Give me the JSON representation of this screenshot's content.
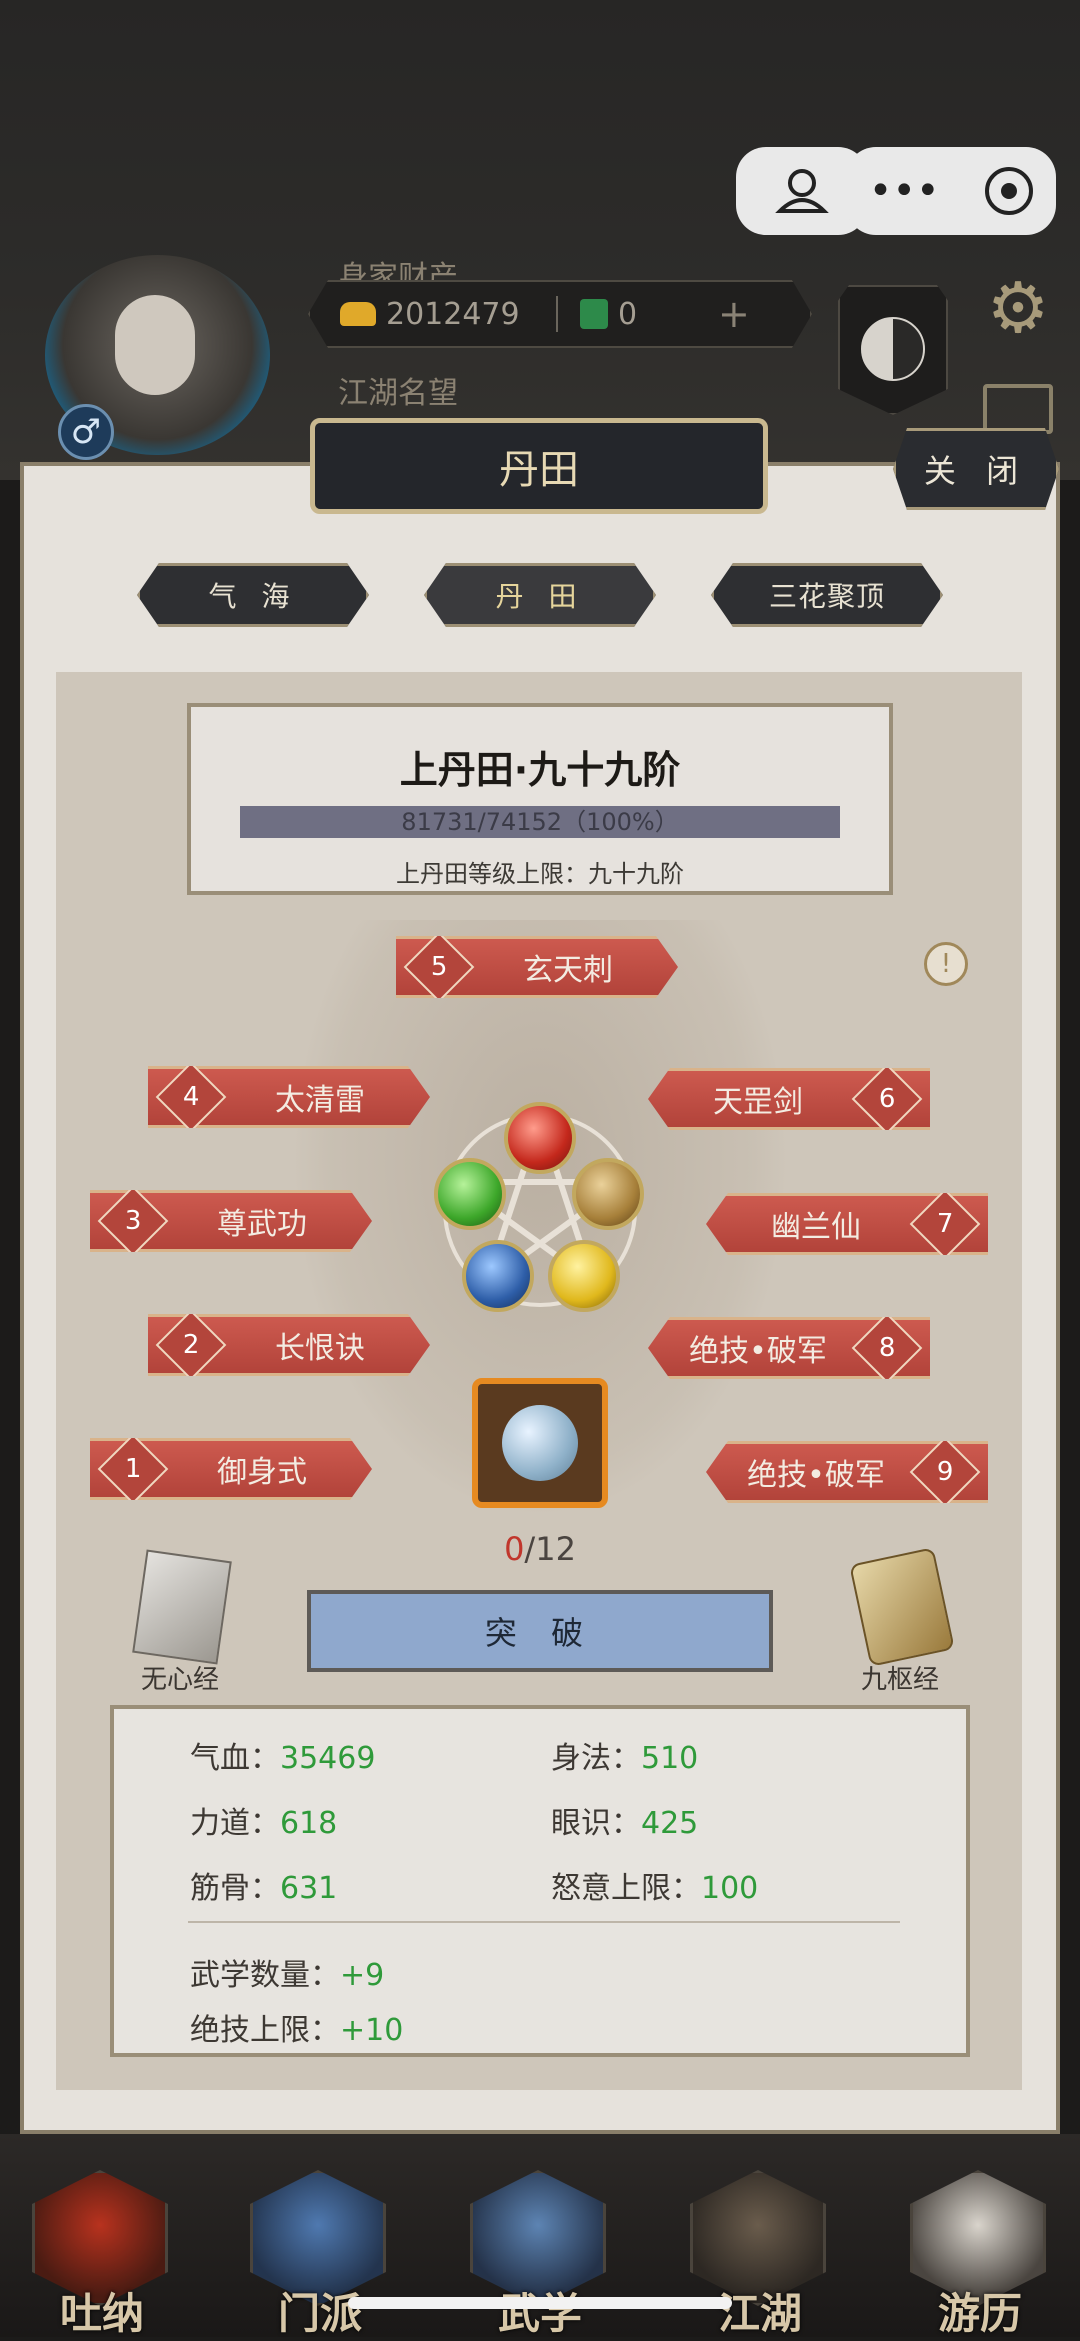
{
  "header": {
    "wealth_label": "身家财产",
    "gold": "2012479",
    "jade": "0",
    "add_symbol": "+",
    "fame_label": "江湖名望",
    "gender_symbol": "♂"
  },
  "panel": {
    "title": "丹田",
    "close_label": "关 闭",
    "tabs": [
      {
        "label": "气 海",
        "active": false
      },
      {
        "label": "丹 田",
        "active": true
      },
      {
        "label": "三花聚顶",
        "active": false
      }
    ],
    "level": {
      "title": "上丹田·九十九阶",
      "progress_text": "81731/74152（100%）",
      "progress_fraction": 1.0,
      "limit_text": "上丹田等级上限：九十九阶"
    },
    "info_symbol": "!",
    "skills": [
      {
        "num": "1",
        "name": "御身式"
      },
      {
        "num": "2",
        "name": "长恨诀"
      },
      {
        "num": "3",
        "name": "尊武功"
      },
      {
        "num": "4",
        "name": "太清雷"
      },
      {
        "num": "5",
        "name": "玄天刺"
      },
      {
        "num": "6",
        "name": "天罡剑"
      },
      {
        "num": "7",
        "name": "幽兰仙"
      },
      {
        "num": "8",
        "name": "绝技•破军"
      },
      {
        "num": "9",
        "name": "绝技•破军"
      }
    ],
    "counter": {
      "current": "0",
      "total": "/12"
    },
    "breakthrough_label": "突 破",
    "left_book": "无心经",
    "right_book": "九枢经",
    "stats": {
      "hp_label": "气血：",
      "hp": "35469",
      "agility_label": "身法：",
      "agility": "510",
      "strength_label": "力道：",
      "strength": "618",
      "insight_label": "眼识：",
      "insight": "425",
      "bone_label": "筋骨：",
      "bone": "631",
      "rage_label": "怒意上限：",
      "rage": "100",
      "martial_count_label": "武学数量：",
      "martial_count": "+9",
      "ult_limit_label": "绝技上限：",
      "ult_limit": "+10"
    }
  },
  "nav": [
    "吐纳",
    "门派",
    "武学",
    "江湖",
    "游历"
  ],
  "colors": {
    "banner_red": "#c04c42",
    "stat_green": "#2f9a3a",
    "progress_bar": "#6f6f83",
    "accent_gold": "#c9b88f"
  }
}
